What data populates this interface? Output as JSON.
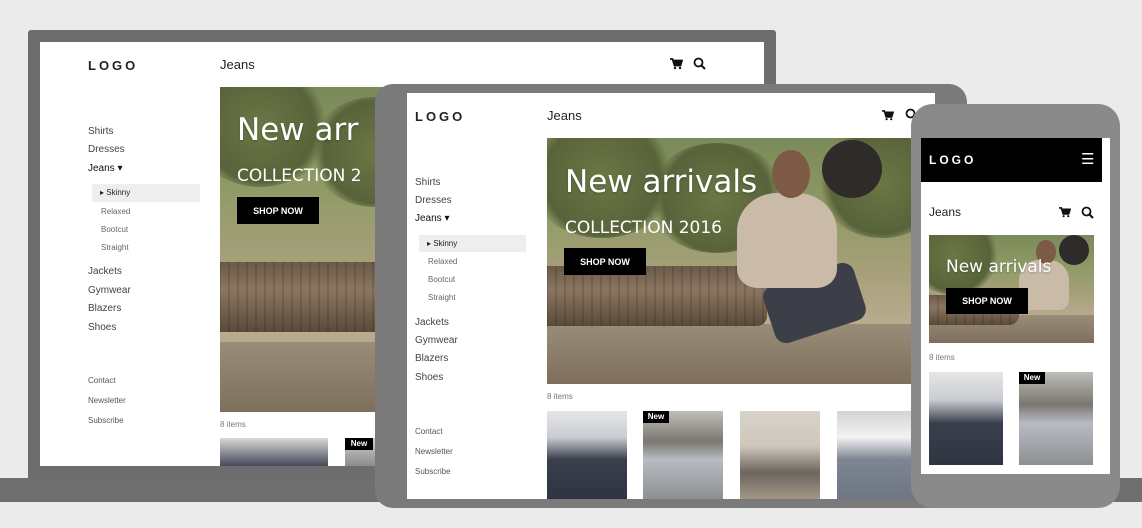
{
  "desktop": {
    "logo": "LOGO",
    "page_title": "Jeans",
    "nav": {
      "shirts": "Shirts",
      "dresses": "Dresses",
      "jeans": "Jeans ▾",
      "sub": {
        "skinny": "▸ Skinny",
        "relaxed": "Relaxed",
        "bootcut": "Bootcut",
        "straight": "Straight"
      },
      "jackets": "Jackets",
      "gymwear": "Gymwear",
      "blazers": "Blazers",
      "shoes": "Shoes"
    },
    "footer": {
      "contact": "Contact",
      "newsletter": "Newsletter",
      "subscribe": "Subscribe"
    },
    "hero": {
      "title": "New arr",
      "subtitle": "COLLECTION 2",
      "button": "SHOP NOW"
    },
    "items_count": "8 items",
    "badge": "New"
  },
  "tablet": {
    "logo": "LOGO",
    "page_title": "Jeans",
    "nav": {
      "shirts": "Shirts",
      "dresses": "Dresses",
      "jeans": "Jeans ▾",
      "sub": {
        "skinny": "▸ Skinny",
        "relaxed": "Relaxed",
        "bootcut": "Bootcut",
        "straight": "Straight"
      },
      "jackets": "Jackets",
      "gymwear": "Gymwear",
      "blazers": "Blazers",
      "shoes": "Shoes"
    },
    "footer": {
      "contact": "Contact",
      "newsletter": "Newsletter",
      "subscribe": "Subscribe"
    },
    "hero": {
      "title": "New arrivals",
      "subtitle": "COLLECTION 2016",
      "button": "SHOP NOW"
    },
    "items_count": "8 items",
    "badge": "New"
  },
  "phone": {
    "logo": "LOGO",
    "menu_icon": "☰",
    "page_title": "Jeans",
    "hero": {
      "title": "New arrivals",
      "button": "SHOP NOW"
    },
    "items_count": "8 items",
    "badge": "New"
  },
  "icons": {
    "cart": "cart-icon",
    "search": "search-icon",
    "menu": "hamburger-menu-icon"
  },
  "colors": {
    "background": "#ebebeb",
    "device_frame": "#6d6d6d",
    "button": "#000000",
    "header_mobile": "#000000"
  }
}
